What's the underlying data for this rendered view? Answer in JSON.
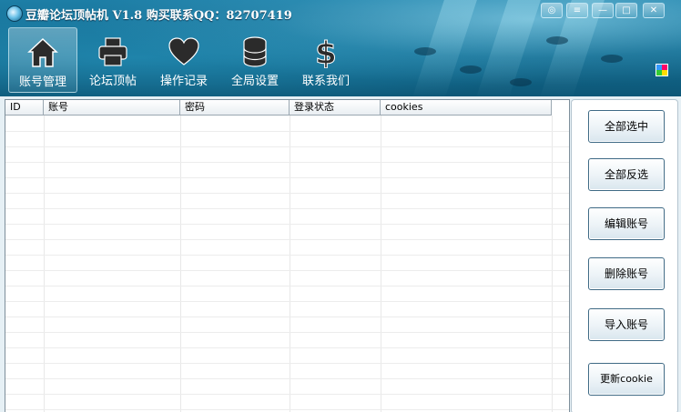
{
  "window": {
    "title": "豆瓣论坛顶帖机 V1.8 购买联系QQ：82707419"
  },
  "title_bar": {
    "controls": [
      {
        "name": "chat-icon",
        "glyph": "◎"
      },
      {
        "name": "menu-icon",
        "glyph": "≡"
      },
      {
        "name": "minimize-icon",
        "glyph": "—"
      },
      {
        "name": "maximize-icon",
        "glyph": "□"
      },
      {
        "name": "close-icon",
        "glyph": "✕"
      }
    ]
  },
  "nav": {
    "items": [
      {
        "label": "账号管理",
        "icon": "home-icon",
        "active": true
      },
      {
        "label": "论坛顶帖",
        "icon": "printer-icon",
        "active": false
      },
      {
        "label": "操作记录",
        "icon": "heart-icon",
        "active": false
      },
      {
        "label": "全局设置",
        "icon": "database-icon",
        "active": false
      },
      {
        "label": "联系我们",
        "icon": "dollar-icon",
        "active": false
      }
    ]
  },
  "table": {
    "columns": [
      "ID",
      "账号",
      "密码",
      "登录状态",
      "cookies"
    ],
    "rows": []
  },
  "actions": {
    "select_all": "全部选中",
    "invert_selection": "全部反选",
    "edit_account": "编辑账号",
    "delete_account": "删除账号",
    "import_account": "导入账号",
    "refresh_cookie": "更新cookie"
  },
  "colors": {
    "banner": "#136b90",
    "button_border": "#3f6a85"
  }
}
